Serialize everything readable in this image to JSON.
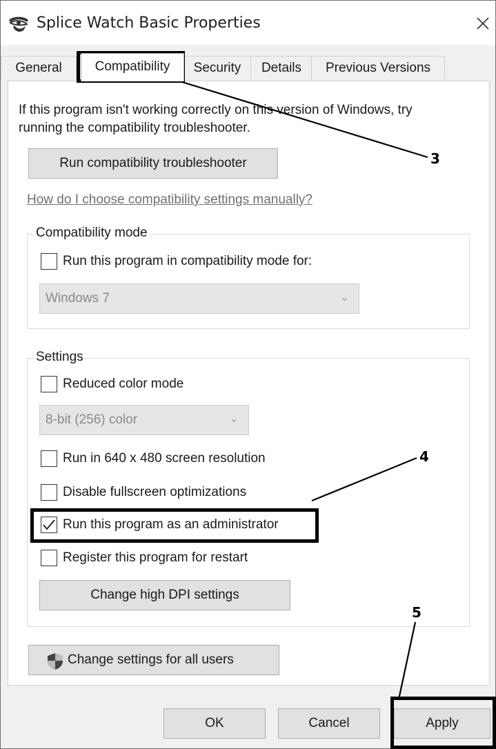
{
  "window": {
    "title": "Splice Watch Basic Properties",
    "icon": "splice-app-icon",
    "close_icon": "close-icon"
  },
  "tabs": [
    {
      "label": "General",
      "active": false
    },
    {
      "label": "Compatibility",
      "active": true
    },
    {
      "label": "Security",
      "active": false
    },
    {
      "label": "Details",
      "active": false
    },
    {
      "label": "Previous Versions",
      "active": false
    }
  ],
  "intro": {
    "line1": "If this program isn't working correctly on this version of Windows, try",
    "line2": "running the compatibility troubleshooter."
  },
  "troubleshooter_button": "Run compatibility troubleshooter",
  "help_link": "How do I choose compatibility settings manually?",
  "compat_mode": {
    "group_label": "Compatibility mode",
    "checkbox_label": "Run this program in compatibility mode for:",
    "checked": false,
    "dropdown_value": "Windows 7"
  },
  "settings": {
    "group_label": "Settings",
    "reduced_color": {
      "label": "Reduced color mode",
      "checked": false
    },
    "color_dropdown_value": "8-bit (256) color",
    "res_640": {
      "label": "Run in 640 x 480 screen resolution",
      "checked": false
    },
    "disable_fullscreen": {
      "label": "Disable fullscreen optimizations",
      "checked": false
    },
    "run_admin": {
      "label": "Run this program as an administrator",
      "checked": true
    },
    "register_restart": {
      "label": "Register this program for restart",
      "checked": false
    },
    "dpi_button": "Change high DPI settings"
  },
  "all_users_button": "Change settings for all users",
  "all_users_icon": "shield-icon",
  "footer": {
    "ok": "OK",
    "cancel": "Cancel",
    "apply": "Apply"
  },
  "callouts": {
    "c3": "3",
    "c4": "4",
    "c5": "5"
  }
}
